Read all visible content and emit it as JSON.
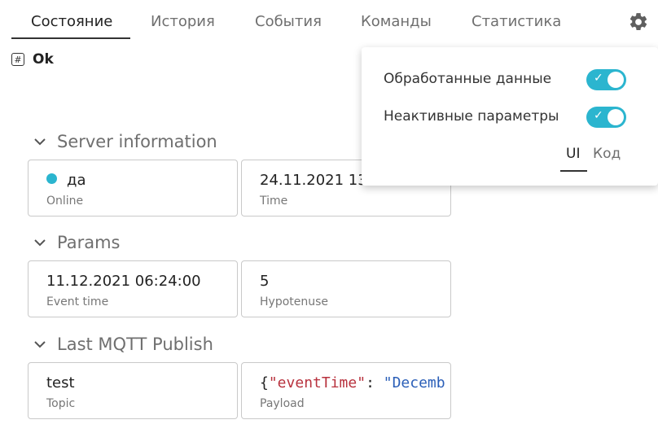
{
  "tabs": [
    {
      "label": "Состояние",
      "active": true
    },
    {
      "label": "История",
      "active": false
    },
    {
      "label": "События",
      "active": false
    },
    {
      "label": "Команды",
      "active": false
    },
    {
      "label": "Статистика",
      "active": false
    }
  ],
  "toolbar": {
    "settings_icon": "gear-icon"
  },
  "status": {
    "icon": "hash-box-icon",
    "text": "Ok"
  },
  "sections": [
    {
      "title": "Server information",
      "cards": [
        {
          "value": "да",
          "label": "Online",
          "indicator_color": "#2bb5cf"
        },
        {
          "value": "24.11.2021 13",
          "label": "Time"
        }
      ]
    },
    {
      "title": "Params",
      "cards": [
        {
          "value": "11.12.2021 06:24:00",
          "label": "Event time"
        },
        {
          "value": "5",
          "label": "Hypotenuse"
        }
      ]
    },
    {
      "title": "Last MQTT Publish",
      "cards": [
        {
          "value": "test",
          "label": "Topic"
        },
        {
          "code_brace": "{",
          "code_key": "\"eventTime\"",
          "code_colon": ": ",
          "code_str": "\"Decemb",
          "label": "Payload"
        }
      ]
    }
  ],
  "popup": {
    "options": [
      {
        "label": "Обработанные данные",
        "enabled": true
      },
      {
        "label": "Неактивные параметры",
        "enabled": true
      }
    ],
    "view_tabs": [
      {
        "label": "UI",
        "active": true
      },
      {
        "label": "Код",
        "active": false
      }
    ],
    "accent_color": "#2bb5cf"
  }
}
